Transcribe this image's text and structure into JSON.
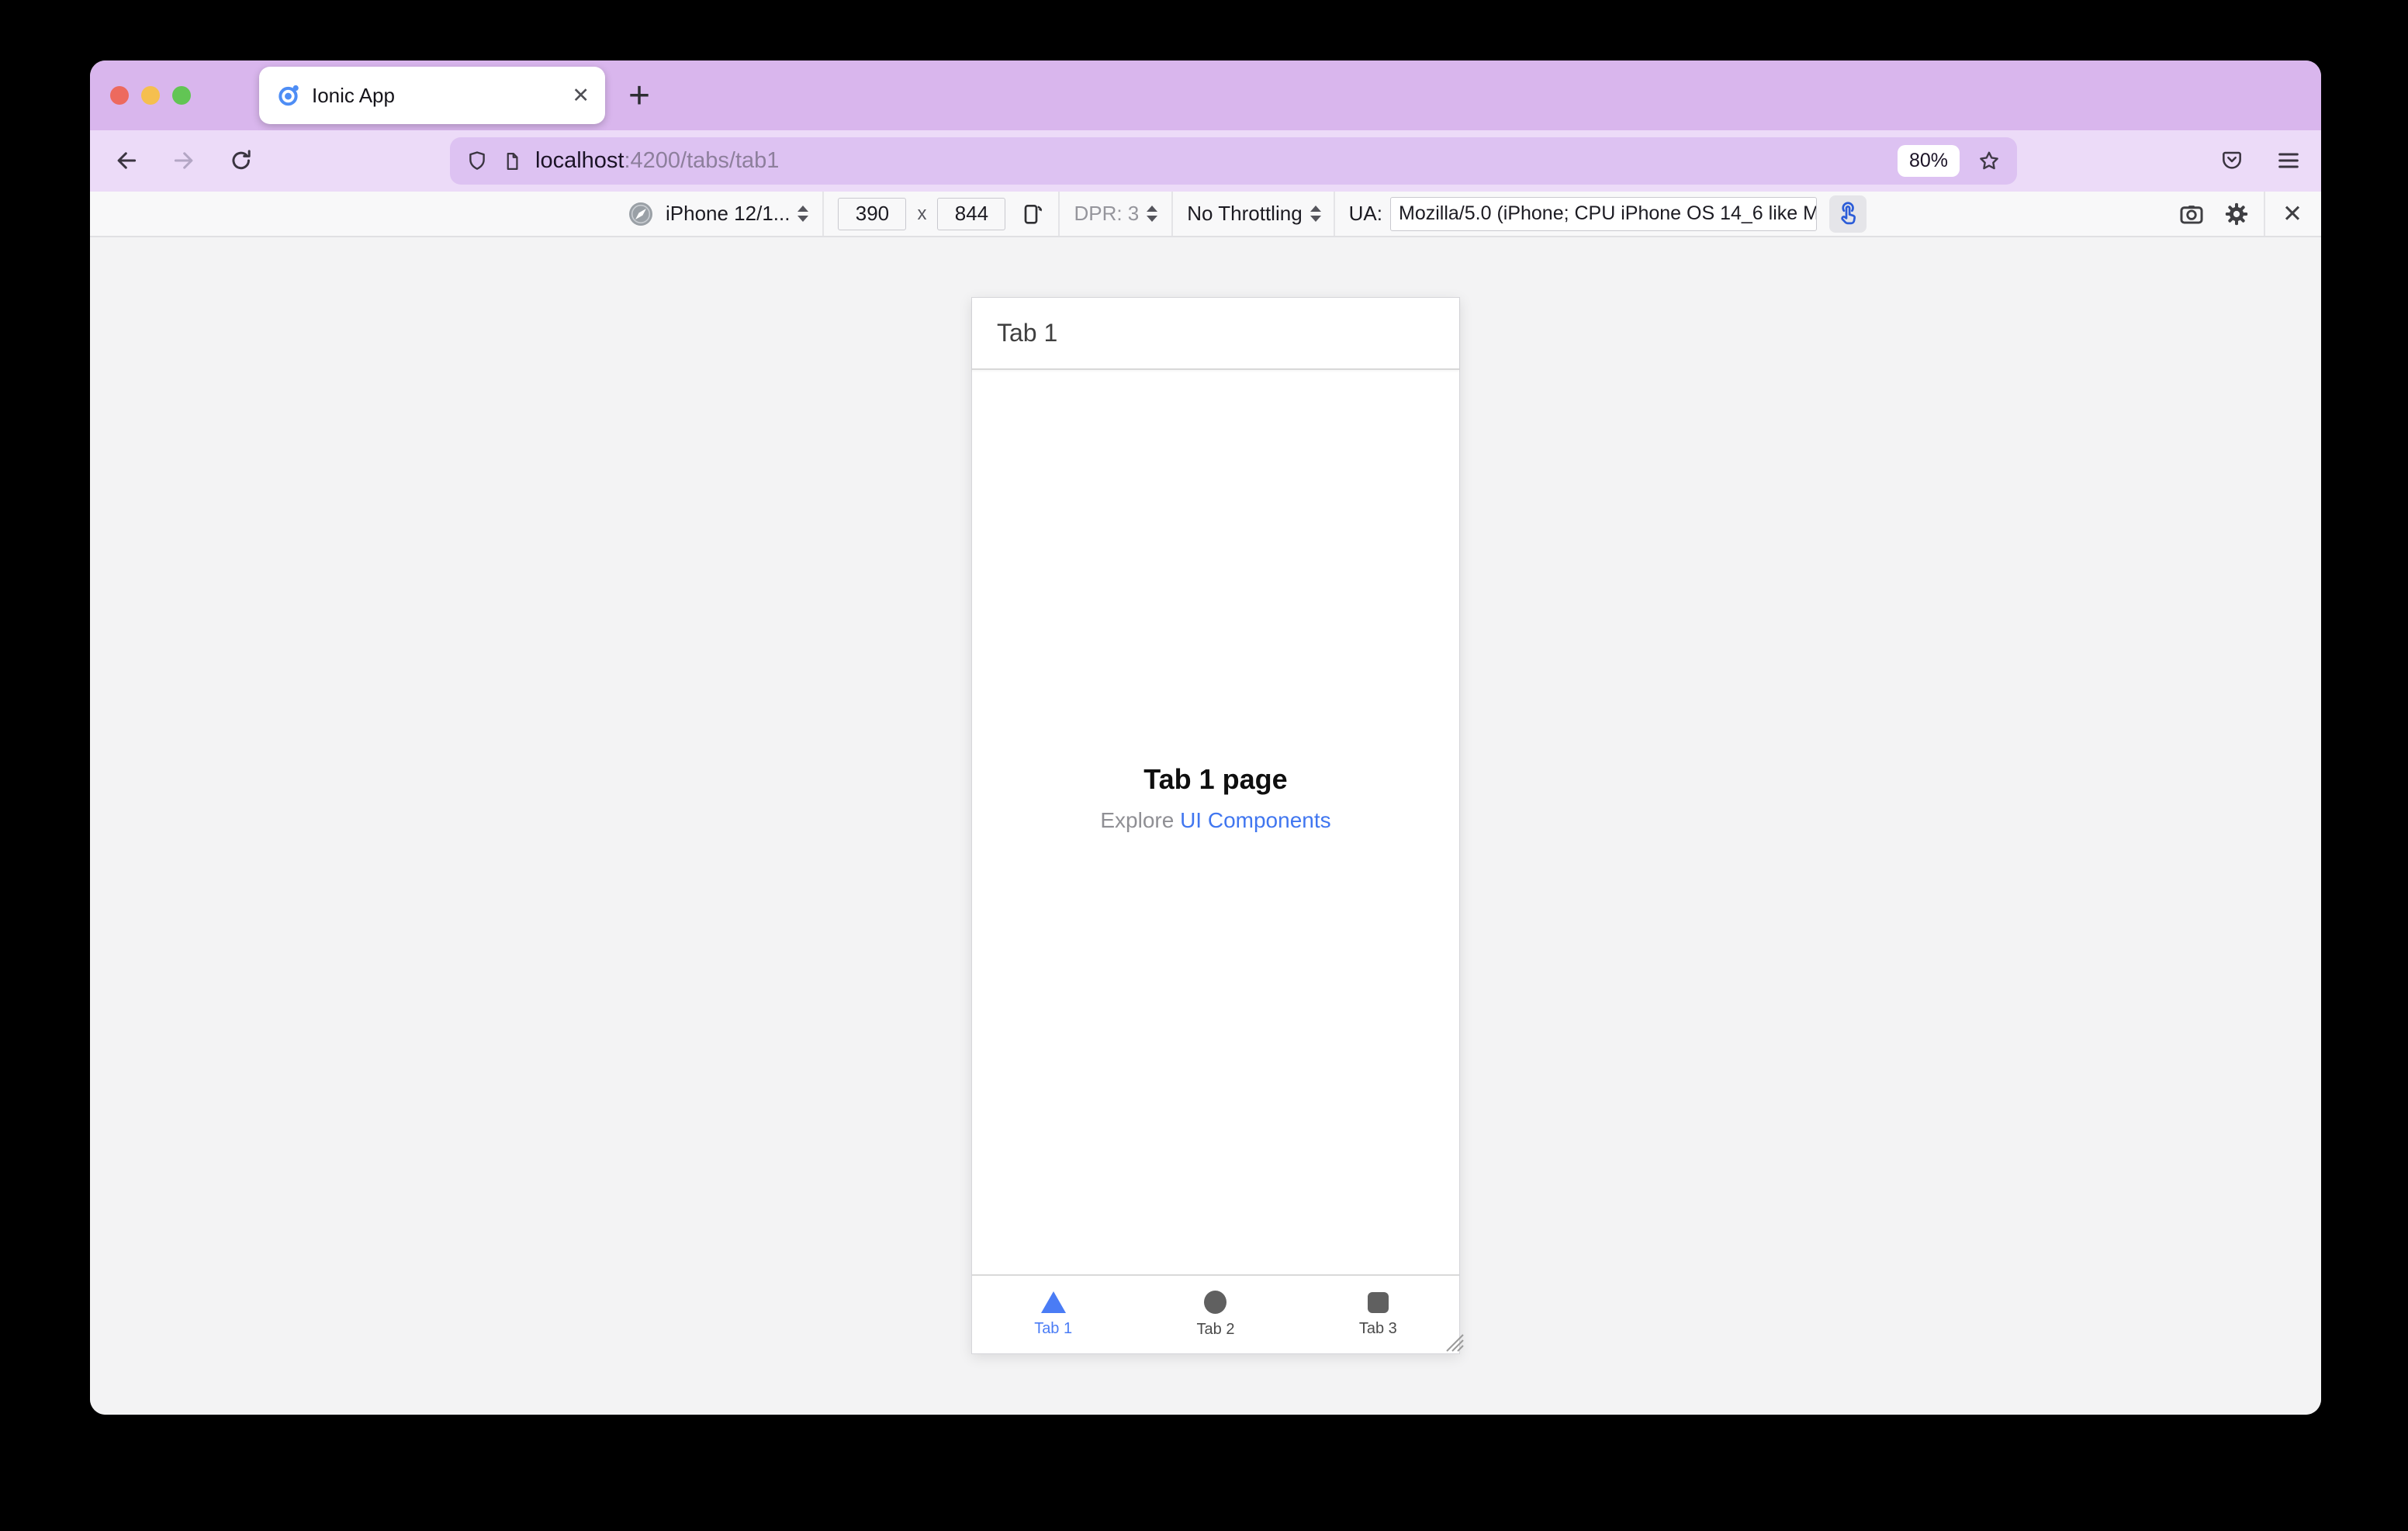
{
  "browser": {
    "traffic_lights": {
      "close": "red",
      "minimize": "yellow",
      "zoom": "green"
    },
    "tab": {
      "title": "Ionic App",
      "favicon": "ionic-logo-icon",
      "close_glyph": "✕"
    },
    "new_tab_glyph": "+",
    "address": {
      "host": "localhost",
      "path": ":4200/tabs/tab1",
      "zoom_badge": "80%"
    }
  },
  "rdm_toolbar": {
    "device_selector": "iPhone 12/1...",
    "viewport_width": "390",
    "times_label": "x",
    "viewport_height": "844",
    "dpr_label": "DPR: 3",
    "throttling_label": "No Throttling",
    "ua_label": "UA:",
    "ua_value": "Mozilla/5.0 (iPhone; CPU iPhone OS 14_6 like M",
    "close_glyph": "✕"
  },
  "device": {
    "header_title": "Tab 1",
    "content": {
      "title": "Tab 1 page",
      "subtitle_prefix": "Explore ",
      "subtitle_link": "UI Components"
    },
    "tab_bar": [
      {
        "label": "Tab 1",
        "icon": "triangle-icon",
        "active": true
      },
      {
        "label": "Tab 2",
        "icon": "circle-icon",
        "active": false
      },
      {
        "label": "Tab 3",
        "icon": "square-icon",
        "active": false
      }
    ]
  },
  "colors": {
    "titlebar_purple": "#d9b6ed",
    "toolbar_purple": "#ecdbf8",
    "urlbar_purple": "#ddc2f2",
    "rdm_toolbar_bg": "#f8f8f9",
    "canvas_gray": "#f3f3f4",
    "ionic_blue": "#4e8df5",
    "link_blue": "#4076f0",
    "active_tab_blue": "#4a7cf5",
    "touch_icon_blue": "#2b5cd8",
    "traffic_red": "#ed6a5e",
    "traffic_yellow": "#f5bf4f",
    "traffic_green": "#62c554"
  }
}
